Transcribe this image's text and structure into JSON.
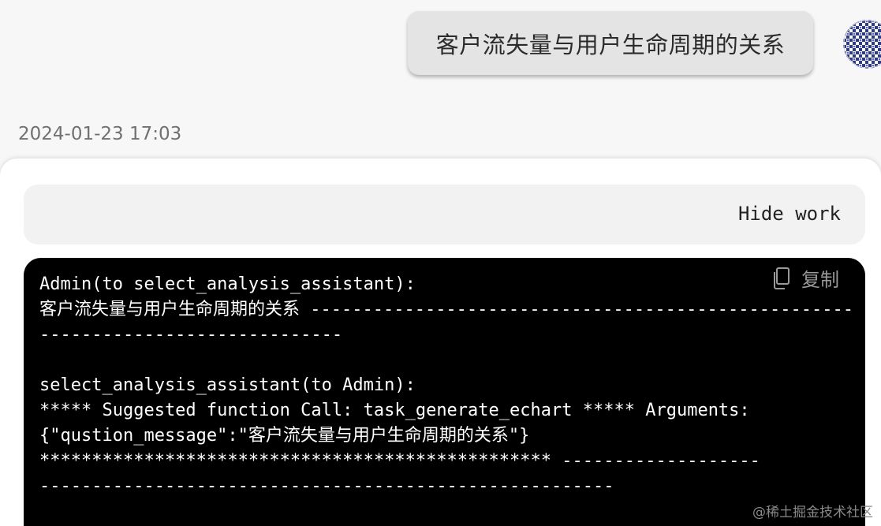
{
  "user_message": {
    "text": "客户流失量与用户生命周期的关系"
  },
  "timestamp": "2024-01-23 17:03",
  "assistant": {
    "hide_work_label": "Hide work",
    "copy_label": "复制",
    "code_lines": [
      "Admin(to select_analysis_assistant):",
      "客户流失量与用户生命周期的关系 ----------------------------------------------------",
      "-----------------------------",
      "",
      "select_analysis_assistant(to Admin):",
      "***** Suggested function Call: task_generate_echart ***** Arguments:",
      "{\"qustion_message\":\"客户流失量与用户生命周期的关系\"}",
      "************************************************* -------------------",
      "-------------------------------------------------------"
    ]
  },
  "watermark": "@稀土掘金技术社区",
  "icons": {
    "copy": "copy-icon",
    "avatar": "avatar"
  },
  "colors": {
    "page_bg": "#f7f7f7",
    "bubble_bg": "#e4e4e4",
    "code_bg": "#000000",
    "code_text": "#ffffff",
    "muted_text": "#9a9a9a"
  }
}
